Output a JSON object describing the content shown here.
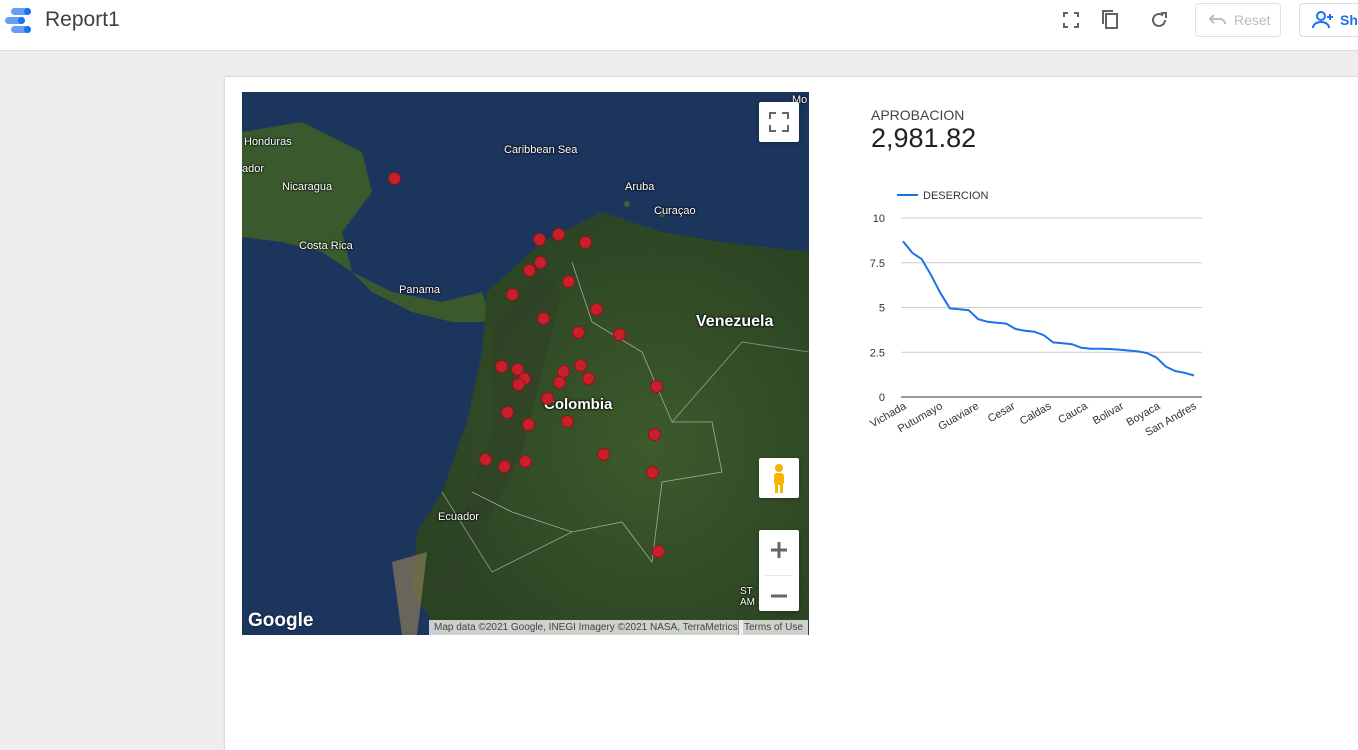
{
  "header": {
    "title": "Report1",
    "reset_label": "Reset",
    "share_label": "Sh"
  },
  "map": {
    "labels": {
      "honduras": "Honduras",
      "ador": "ador",
      "nicaragua": "Nicaragua",
      "costa_rica": "Costa Rica",
      "panama": "Panama",
      "caribbean": "Caribbean Sea",
      "aruba": "Aruba",
      "curacao": "Curaçao",
      "venezuela": "Venezuela",
      "colombia": "Colombia",
      "ecuador": "Ecuador",
      "mo": "Mo",
      "st_am": "ST\nAM"
    },
    "google_logo": "Google",
    "attribution": "Map data ©2021 Google, INEGI Imagery ©2021 NASA, TerraMetrics",
    "terms": "Terms of Use",
    "marker_color": "#c8202a",
    "marker_count": 38
  },
  "scorecard": {
    "label": "APROBACION",
    "value": "2,981.82"
  },
  "chart_data": {
    "type": "line",
    "series": [
      {
        "name": "DESERCION",
        "color": "#1a73e8",
        "values": [
          8.7,
          8.05,
          7.7,
          6.8,
          5.8,
          4.95,
          4.9,
          4.85,
          4.35,
          4.2,
          4.15,
          4.1,
          3.8,
          3.7,
          3.65,
          3.45,
          3.05,
          3.0,
          2.95,
          2.75,
          2.7,
          2.7,
          2.68,
          2.65,
          2.6,
          2.55,
          2.45,
          2.2,
          1.7,
          1.45,
          1.35,
          1.2
        ]
      }
    ],
    "x_tick_labels": [
      "Vichada",
      "Putumayo",
      "Guaviare",
      "Cesar",
      "Caldas",
      "Cauca",
      "Bolivar",
      "Boyaca",
      "San Andres"
    ],
    "y_ticks": [
      "0",
      "2.5",
      "5",
      "7.5",
      "10"
    ],
    "ylim": [
      0,
      10
    ],
    "legend_position": "top-left",
    "grid": true
  }
}
